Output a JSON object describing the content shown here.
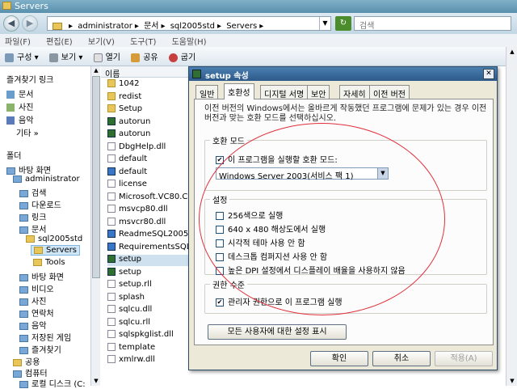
{
  "window": {
    "title": "Servers"
  },
  "nav": {
    "back": "◀",
    "forward": "▶",
    "breadcrumb": [
      "administrator",
      "문서",
      "sql2005std",
      "Servers"
    ],
    "separator": "▸",
    "search_placeholder": "검색"
  },
  "menu": [
    "파일(F)",
    "편집(E)",
    "보기(V)",
    "도구(T)",
    "도움말(H)"
  ],
  "toolbar": [
    {
      "label": "구성",
      "icon": "organize-icon"
    },
    {
      "label": "보기",
      "icon": "views-icon"
    },
    {
      "label": "열기",
      "icon": "open-icon"
    },
    {
      "label": "공유",
      "icon": "share-icon"
    },
    {
      "label": "굽기",
      "icon": "burn-icon"
    }
  ],
  "left": {
    "favorites_header": "즐겨찾기 링크",
    "favorites": [
      "문서",
      "사진",
      "음악"
    ],
    "more": "기타  »",
    "folders_header": "폴더",
    "tree": [
      "바탕 화면",
      "administrator",
      "검색",
      "다운로드",
      "링크",
      "문서",
      "sql2005std",
      "Servers",
      "Tools",
      "바탕 화면",
      "비디오",
      "사진",
      "연락처",
      "음악",
      "저장된 게임",
      "즐겨찾기",
      "공용",
      "컴퓨터",
      "로컬 디스크 (C:"
    ]
  },
  "files": {
    "column": "이름",
    "items": [
      {
        "name": "1042",
        "type": "folder"
      },
      {
        "name": "redist",
        "type": "folder"
      },
      {
        "name": "Setup",
        "type": "folder"
      },
      {
        "name": "autorun",
        "type": "app"
      },
      {
        "name": "autorun",
        "type": "app"
      },
      {
        "name": "DbgHelp.dll",
        "type": "file"
      },
      {
        "name": "default",
        "type": "file"
      },
      {
        "name": "default",
        "type": "ie"
      },
      {
        "name": "license",
        "type": "file"
      },
      {
        "name": "Microsoft.VC80.CF",
        "type": "file"
      },
      {
        "name": "msvcp80.dll",
        "type": "file"
      },
      {
        "name": "msvcr80.dll",
        "type": "file"
      },
      {
        "name": "ReadmeSQL2005",
        "type": "ie"
      },
      {
        "name": "RequirementsSQL2",
        "type": "ie"
      },
      {
        "name": "setup",
        "type": "app"
      },
      {
        "name": "setup",
        "type": "app"
      },
      {
        "name": "setup.rll",
        "type": "file"
      },
      {
        "name": "splash",
        "type": "file"
      },
      {
        "name": "sqlcu.dll",
        "type": "file"
      },
      {
        "name": "sqlcu.rll",
        "type": "file"
      },
      {
        "name": "sqlspkglist.dll",
        "type": "file"
      },
      {
        "name": "template",
        "type": "file"
      },
      {
        "name": "xmlrw.dll",
        "type": "file"
      }
    ]
  },
  "dialog": {
    "title": "setup 속성",
    "close": "✕",
    "tabs": [
      "일반",
      "호환성",
      "디지털 서명",
      "보안",
      "자세히",
      "이전 버전"
    ],
    "active_tab": "호환성",
    "description": "이전 버전의 Windows에서는 올바르게 작동했던 프로그램에 문제가 있는 경우 이전 버전과 맞는 호환 모드를 선택하십시오.",
    "compat_group": "호환 모드",
    "compat_checkbox": "이 프로그램을 실행할 호환 모드:",
    "compat_mode": "Windows Server 2003(서비스 팩 1)",
    "settings_group": "설정",
    "settings": [
      "256색으로 실행",
      "640 x 480 해상도에서 실행",
      "시각적 테마 사용 안 함",
      "데스크톱 컴퍼지션 사용 안 함",
      "높은 DPI 설정에서 디스플레이 배율을 사용하지 않음"
    ],
    "privilege_group": "권한 수준",
    "privilege_checkbox": "관리자 권한으로 이 프로그램 실행",
    "all_users_button": "모든 사용자에 대한 설정 표시",
    "ok": "확인",
    "cancel": "취소",
    "apply": "적용(A)"
  },
  "colors": {
    "annotation_circle": "#e0303a",
    "title_bar": "#2d5a8a"
  }
}
